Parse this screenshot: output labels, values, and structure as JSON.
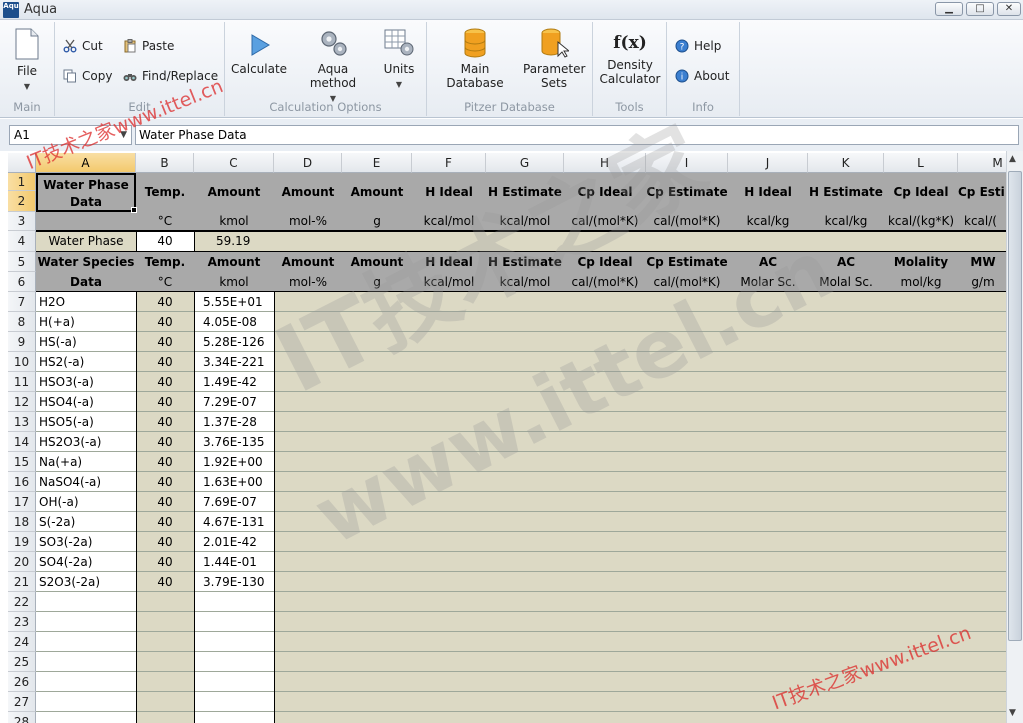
{
  "window": {
    "title": "Aqua",
    "icon_text": "Aqu",
    "buttons": [
      "▁",
      "□",
      "✕"
    ]
  },
  "ribbon": {
    "main": {
      "file": "File",
      "label": "Main"
    },
    "edit": {
      "cut": "Cut",
      "copy": "Copy",
      "paste": "Paste",
      "find_replace": "Find/Replace",
      "label": "Edit"
    },
    "calc": {
      "calculate": "Calculate",
      "aqua_method": "Aqua method",
      "units": "Units",
      "label": "Calculation Options"
    },
    "pitzer": {
      "main_database": "Main Database",
      "parameter_sets": "Parameter Sets",
      "label": "Pitzer Database"
    },
    "tools": {
      "fx": "f(x)",
      "density": "Density Calculator",
      "label": "Tools"
    },
    "info": {
      "help": "Help",
      "about": "About",
      "label": "Info"
    }
  },
  "formula_bar": {
    "name_box": "A1",
    "formula": "Water Phase Data"
  },
  "columns": [
    "A",
    "B",
    "C",
    "D",
    "E",
    "F",
    "G",
    "H",
    "I",
    "J",
    "K",
    "L",
    "M"
  ],
  "rows": [
    "1",
    "2",
    "3",
    "4",
    "5",
    "6",
    "7",
    "8",
    "9",
    "10",
    "11",
    "12",
    "13",
    "14",
    "15",
    "16",
    "17",
    "18",
    "19",
    "20",
    "21",
    "22",
    "23",
    "24",
    "25",
    "26",
    "27",
    "28"
  ],
  "phase_header": {
    "title": "Water Phase Data",
    "labels": [
      "Temp.",
      "Amount",
      "Amount",
      "Amount",
      "H Ideal",
      "H Estimate",
      "Cp Ideal",
      "Cp Estimate",
      "H Ideal",
      "H Estimate",
      "Cp Ideal",
      "Cp Esti"
    ],
    "units": [
      "°C",
      "kmol",
      "mol-%",
      "g",
      "kcal/mol",
      "kcal/mol",
      "cal/(mol*K)",
      "cal/(mol*K)",
      "kcal/kg",
      "kcal/kg",
      "kcal/(kg*K)",
      "kcal/("
    ]
  },
  "phase_row": {
    "name": "Water Phase",
    "temp": "40",
    "amount": "59.19"
  },
  "species_header": {
    "title_line1": "Water Species",
    "title_line2": "Data",
    "labels": [
      "Temp.",
      "Amount",
      "Amount",
      "Amount",
      "H Ideal",
      "H Estimate",
      "Cp Ideal",
      "Cp Estimate",
      "AC",
      "AC",
      "Molality",
      "MW"
    ],
    "units": [
      "°C",
      "kmol",
      "mol-%",
      "g",
      "kcal/mol",
      "kcal/mol",
      "cal/(mol*K)",
      "cal/(mol*K)",
      "Molar Sc.",
      "Molal Sc.",
      "mol/kg",
      "g/m"
    ]
  },
  "species": [
    {
      "name": "H2O",
      "temp": "40",
      "amount": "5.55E+01"
    },
    {
      "name": "H(+a)",
      "temp": "40",
      "amount": "4.05E-08"
    },
    {
      "name": "HS(-a)",
      "temp": "40",
      "amount": "5.28E-126"
    },
    {
      "name": "HS2(-a)",
      "temp": "40",
      "amount": "3.34E-221"
    },
    {
      "name": "HSO3(-a)",
      "temp": "40",
      "amount": "1.49E-42"
    },
    {
      "name": "HSO4(-a)",
      "temp": "40",
      "amount": "7.29E-07"
    },
    {
      "name": "HSO5(-a)",
      "temp": "40",
      "amount": "1.37E-28"
    },
    {
      "name": "HS2O3(-a)",
      "temp": "40",
      "amount": "3.76E-135"
    },
    {
      "name": "Na(+a)",
      "temp": "40",
      "amount": "1.92E+00"
    },
    {
      "name": "NaSO4(-a)",
      "temp": "40",
      "amount": "1.63E+00"
    },
    {
      "name": "OH(-a)",
      "temp": "40",
      "amount": "7.69E-07"
    },
    {
      "name": "S(-2a)",
      "temp": "40",
      "amount": "4.67E-131"
    },
    {
      "name": "SO3(-2a)",
      "temp": "40",
      "amount": "2.01E-42"
    },
    {
      "name": "SO4(-2a)",
      "temp": "40",
      "amount": "1.44E-01"
    },
    {
      "name": "S2O3(-2a)",
      "temp": "40",
      "amount": "3.79E-130"
    }
  ],
  "watermark": {
    "big": "IT技术之家",
    "url": "www.ittel.cn",
    "small": "IT技术之家www.ittel.cn",
    "corner": "ittel.cn"
  },
  "colors": {
    "header_gray": "#a9a9a9",
    "tan": "#dcd9c4",
    "selection": "#f3c96d"
  }
}
